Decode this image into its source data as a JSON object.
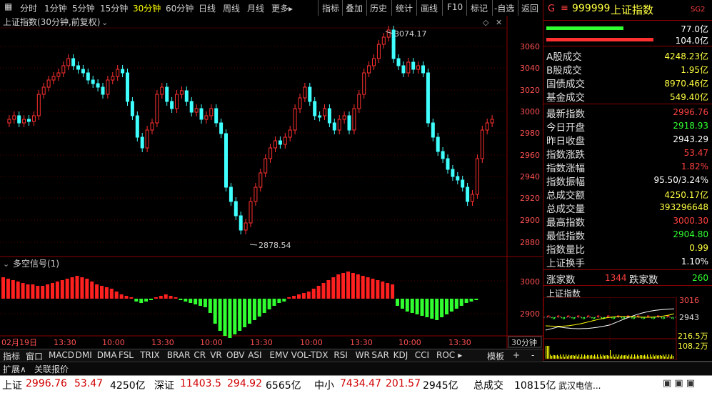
{
  "toolbar": {
    "periods": [
      "分时",
      "1分钟",
      "5分钟",
      "15分钟",
      "30分钟",
      "60分钟",
      "日线",
      "周线",
      "月线",
      "更多▸"
    ],
    "active_period": "30分钟",
    "tools": [
      "指标",
      "叠加",
      "历史",
      "统计",
      "画线",
      "F10",
      "标记",
      "-自选",
      "返回"
    ]
  },
  "chart": {
    "title": "上证指数(30分钟,前复权)",
    "high_label": "3074.17",
    "low_label": "2878.54",
    "y_ticks": [
      "3060",
      "3040",
      "3020",
      "3000",
      "2980",
      "2960",
      "2940",
      "2920",
      "2900",
      "2880"
    ],
    "indicator_title": "多空信号(1)",
    "ind_ticks": [
      "3000",
      "2900"
    ],
    "x_labels": [
      "02月19日",
      "13:30",
      "10:00",
      "13:30",
      "10:00",
      "13:30",
      "10:00",
      "13:30",
      "10:00",
      "13:30"
    ],
    "period_box": "30分钟"
  },
  "panel": {
    "code": "999999",
    "name": "上证指数",
    "g": "G",
    "flag": "SG2",
    "bar1_val": "77.0亿",
    "bar2_val": "104.0亿",
    "volume_rows": [
      {
        "label": "A股成交",
        "value": "4248.23亿"
      },
      {
        "label": "B股成交",
        "value": "1.95亿"
      },
      {
        "label": "国债成交",
        "value": "8970.46亿"
      },
      {
        "label": "基金成交",
        "value": "549.40亿"
      }
    ],
    "quote_rows": [
      {
        "label": "最新指数",
        "value": "2996.76",
        "color": "red"
      },
      {
        "label": "今日开盘",
        "value": "2918.93",
        "color": "green"
      },
      {
        "label": "昨日收盘",
        "value": "2943.29",
        "color": "white"
      },
      {
        "label": "指数涨跌",
        "value": "53.47",
        "color": "red"
      },
      {
        "label": "指数涨幅",
        "value": "1.82%",
        "color": "red"
      },
      {
        "label": "指数振幅",
        "value": "95.50/3.24%",
        "color": "white"
      },
      {
        "label": "总成交额",
        "value": "4250.17亿",
        "color": "yellow"
      },
      {
        "label": "总成交量",
        "value": "393296648",
        "color": "yellow"
      },
      {
        "label": "最高指数",
        "value": "3000.30",
        "color": "red"
      },
      {
        "label": "最低指数",
        "value": "2904.80",
        "color": "green"
      },
      {
        "label": "指数量比",
        "value": "0.99",
        "color": "yellow"
      },
      {
        "label": "上证换手",
        "value": "1.10%",
        "color": "white"
      }
    ],
    "up_label": "涨家数",
    "up_val": "1344",
    "down_label": "跌家数",
    "down_val": "260",
    "mini_title": "上证指数",
    "mini_ticks": [
      "3016",
      "2943",
      "216.5万",
      "108.2万"
    ],
    "tabs": [
      "笔",
      "价",
      "细",
      "势",
      "联",
      "值",
      "主",
      "筹"
    ]
  },
  "bottom_tabs": [
    "指标",
    "窗口",
    "MACD",
    "DMI",
    "DMA",
    "FSL",
    "TRIX",
    "BRAR",
    "CR",
    "VR",
    "OBV",
    "ASI",
    "EMV",
    "VOL-TDX",
    "RSI",
    "WR",
    "SAR",
    "KDJ",
    "CCI",
    "ROC",
    "▸",
    "模板",
    "+",
    "-"
  ],
  "sub_tabs": [
    "扩展∧",
    "关联报价"
  ],
  "status": {
    "sh_label": "上证",
    "sh_price": "2996.76",
    "sh_chg": "53.47",
    "sh_amt": "4250亿",
    "sz_label": "深证",
    "sz_price": "11403.5",
    "sz_chg": "294.92",
    "sz_amt": "6565亿",
    "zx_label": "中小",
    "zx_price": "7434.47",
    "zx_chg": "201.57",
    "zx_amt": "2945亿",
    "total_label": "总成交",
    "total_amt": "10815亿",
    "extra": "武汉电信..."
  }
}
